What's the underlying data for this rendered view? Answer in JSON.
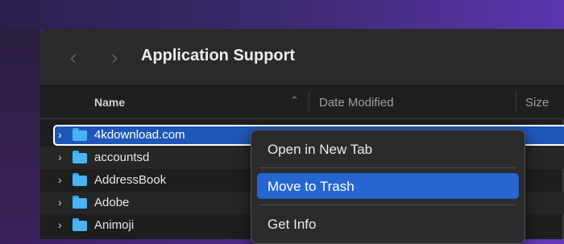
{
  "toolbar": {
    "back_glyph": "‹",
    "forward_glyph": "›",
    "title": "Application Support"
  },
  "header": {
    "name": "Name",
    "sort_glyph": "⌃",
    "date_modified": "Date Modified",
    "size": "Size"
  },
  "rows": [
    {
      "name": "4kdownload.com",
      "selected": true
    },
    {
      "name": "accountsd"
    },
    {
      "name": "AddressBook"
    },
    {
      "name": "Adobe"
    },
    {
      "name": "Animoji"
    }
  ],
  "chevron_glyph": "›",
  "context_menu": {
    "items": [
      {
        "label": "Open in New Tab"
      },
      {
        "label": "Move to Trash",
        "highlighted": true
      },
      {
        "label": "Get Info"
      }
    ]
  },
  "colors": {
    "selection": "#1f57b8",
    "menu_highlight": "#2566d1",
    "folder": "#48b4f5"
  }
}
